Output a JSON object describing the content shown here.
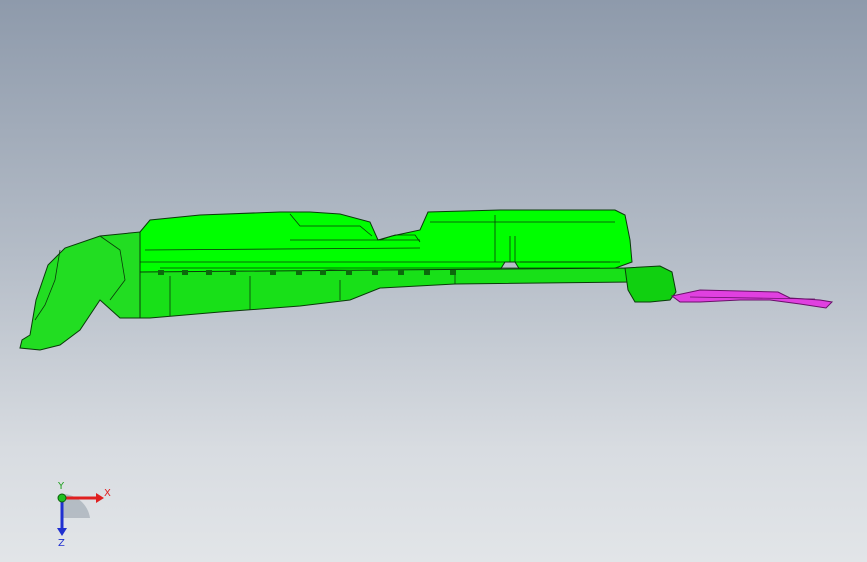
{
  "viewport": {
    "background_top": "#8e9aab",
    "background_bottom": "#e2e5e8"
  },
  "model": {
    "main_part_color": "#00ff00",
    "main_part_edge_color": "#0a3a0a",
    "secondary_part_color": "#e040e0",
    "secondary_part_edge_color": "#6a106a"
  },
  "triad": {
    "x_label": "X",
    "y_label": "Y",
    "z_label": "Z",
    "x_color": "#e02020",
    "y_color": "#20c020",
    "z_color": "#2030d0"
  }
}
